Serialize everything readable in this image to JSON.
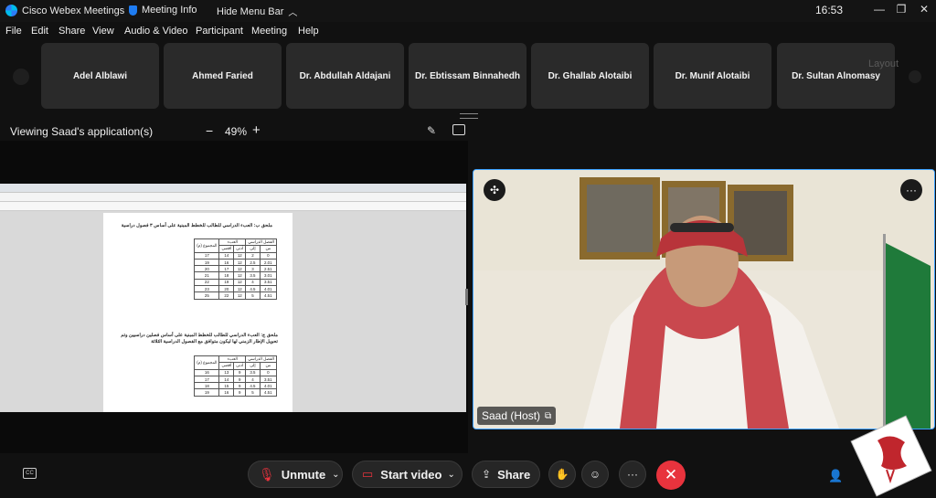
{
  "titlebar": {
    "app_name": "Cisco Webex Meetings",
    "meeting_info": "Meeting Info",
    "hide_menu": "Hide Menu Bar",
    "time": "16:53"
  },
  "menu": [
    "File",
    "Edit",
    "Share",
    "View",
    "Audio & Video",
    "Participant",
    "Meeting",
    "Help"
  ],
  "participants": [
    "Adel Alblawi",
    "Ahmed Faried",
    "Dr. Abdullah Aldajani",
    "Dr. Ebtissam Binnahedh",
    "Dr. Ghallab Alotaibi",
    "Dr. Munif Alotaibi",
    "Dr. Sultan Alnomasy"
  ],
  "layout_label": "Layout",
  "share": {
    "viewing_label": "Viewing Saad's application(s)",
    "zoom": "49%",
    "zoom_minus": "−",
    "zoom_plus": "+"
  },
  "document": {
    "caption1": "ملحق ب: العبء الدراسي للطالب للخطط المبنية على أساس ٣ فصول دراسية",
    "caption2": "ملحق ج: العبء الدراسي للطالب للخطط المبنية على أساس فصلين دراسيين وتم تحويل الإطار الزمني لها ليكون متوافق مع الفصول الدراسية الثلاثة",
    "table1_header": [
      "الفصل الدراسي",
      "العبء",
      "المجموع (م)"
    ],
    "table1_subheader": [
      "من",
      "إلى",
      "أدنى",
      "أقصى"
    ],
    "table1_rows": [
      [
        "0",
        "2",
        "12",
        "14",
        "17"
      ],
      [
        "2.01",
        "2.5",
        "12",
        "16",
        "19"
      ],
      [
        "2.51",
        "3",
        "12",
        "17",
        "20"
      ],
      [
        "3.01",
        "3.5",
        "12",
        "18",
        "21"
      ],
      [
        "3.51",
        "4",
        "12",
        "19",
        "22"
      ],
      [
        "4.01",
        "4.5",
        "12",
        "20",
        "23"
      ],
      [
        "4.51",
        "5",
        "12",
        "22",
        "25"
      ]
    ],
    "table2_header": [
      "الفصل الدراسي",
      "العبء",
      "المجموع (م)"
    ],
    "table2_subheader": [
      "من",
      "إلى",
      "أدنى",
      "أقصى"
    ],
    "table2_rows": [
      [
        "0",
        "3.5",
        "9",
        "13",
        "16"
      ],
      [
        "3.51",
        "4",
        "9",
        "14",
        "17"
      ],
      [
        "4.01",
        "4.5",
        "9",
        "15",
        "18"
      ],
      [
        "4.51",
        "5",
        "9",
        "16",
        "19"
      ]
    ]
  },
  "video": {
    "host_label": "Saad (Host)"
  },
  "controls": {
    "unmute": "Unmute",
    "start_video": "Start video",
    "share": "Share"
  },
  "colors": {
    "accent_blue": "#3aa0ff",
    "end_red": "#e8333d",
    "tile_bg": "#2a2a2a",
    "background": "#111111"
  }
}
